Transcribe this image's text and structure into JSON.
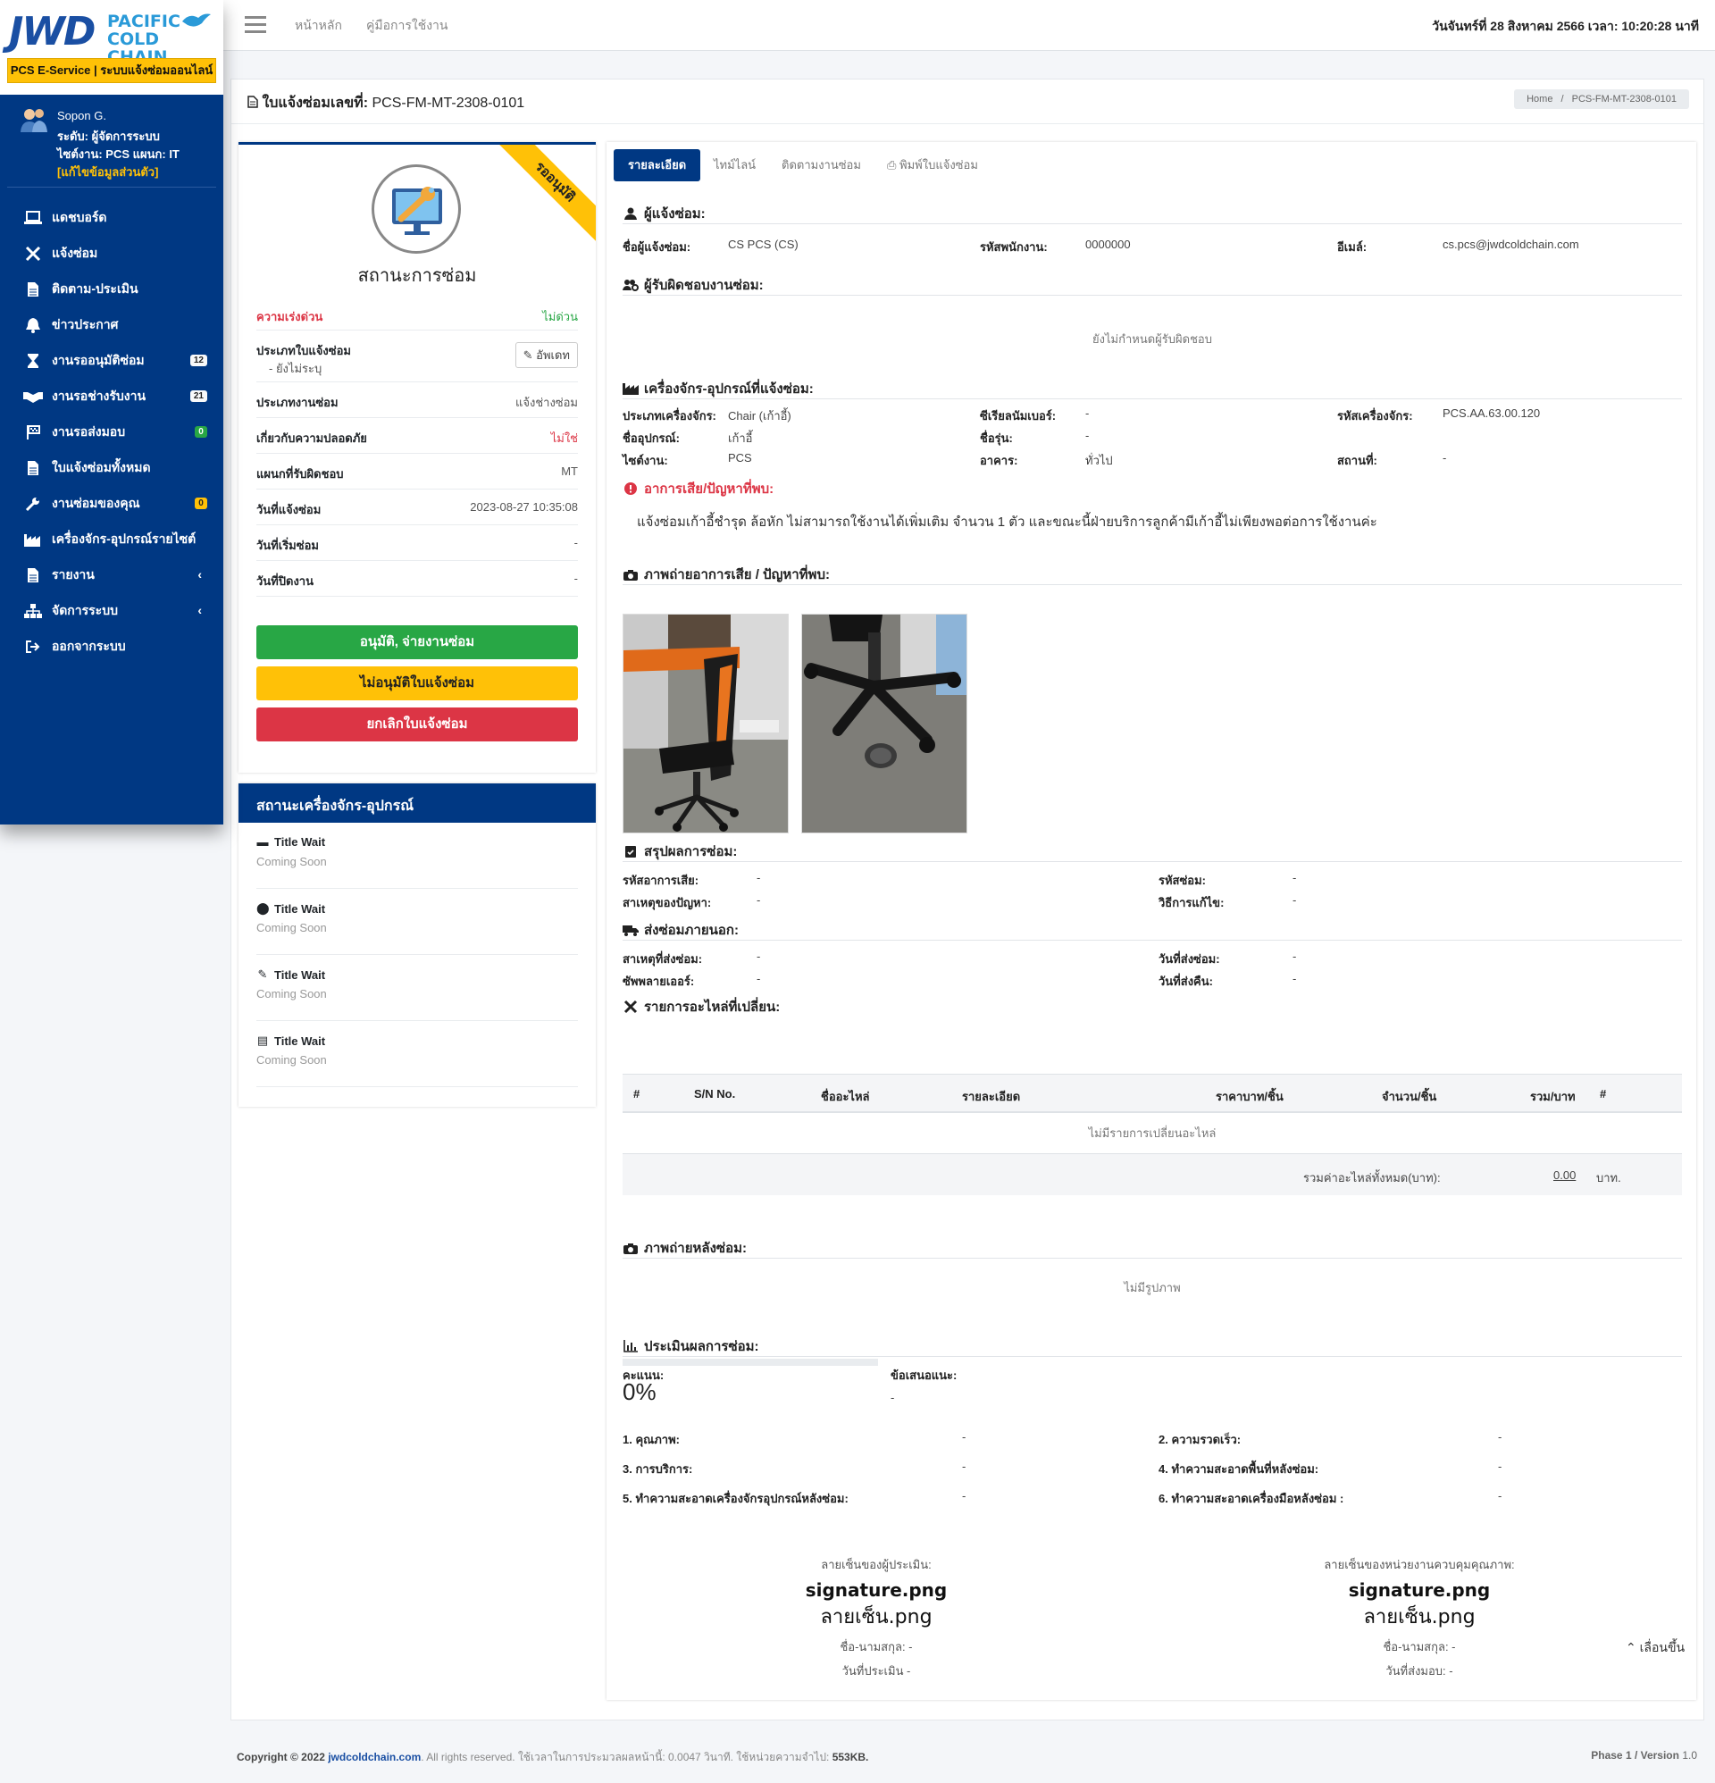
{
  "brand": {
    "logo_text": "JWD",
    "line1": "PACIFIC",
    "line2": "COLD CHAIN",
    "service_label": "PCS E-Service | ระบบแจ้งซ่อมออนไลน์"
  },
  "user": {
    "name": "Sopon G.",
    "level": "ระดับ: ผู้จัดการระบบ",
    "site": "ไซต์งาน: PCS แผนก: IT",
    "edit_link": "[แก้ไขข้อมูลส่วนตัว]"
  },
  "nav": [
    {
      "label": "แดชบอร์ด",
      "icon": "laptop-icon"
    },
    {
      "label": "แจ้งซ่อม",
      "icon": "tools-icon"
    },
    {
      "label": "ติดตาม-ประเมิน",
      "icon": "file-icon"
    },
    {
      "label": "ข่าวประกาศ",
      "icon": "bell-icon"
    },
    {
      "label": "งานรออนุมัติซ่อม",
      "icon": "hourglass-icon",
      "badge": "12"
    },
    {
      "label": "งานรอช่างรับงาน",
      "icon": "handshake-icon",
      "badge": "21"
    },
    {
      "label": "งานรอส่งมอบ",
      "icon": "flag-icon",
      "badge": "0"
    },
    {
      "label": "ใบแจ้งซ่อมทั้งหมด",
      "icon": "file-icon"
    },
    {
      "label": "งานซ่อมของคุณ",
      "icon": "wrench-icon",
      "badge": "0"
    },
    {
      "label": "เครื่องจักร-อุปกรณ์รายไซต์",
      "icon": "industry-icon"
    },
    {
      "label": "รายงาน",
      "icon": "file-icon"
    },
    {
      "label": "จัดการระบบ",
      "icon": "sitemap-icon"
    },
    {
      "label": "ออกจากระบบ",
      "icon": "signout-icon"
    }
  ],
  "topbar": {
    "home": "หน้าหลัก",
    "manual": "คู่มือการใช้งาน",
    "datetime": "วันจันทร์ที่ 28 สิงหาคม 2566 เวลา: 10:20:28 นาที"
  },
  "page": {
    "title_prefix": "ใบแจ้งซ่อมเลขที่:",
    "ticket_no": "PCS-FM-MT-2308-0101",
    "crumb_home": "Home",
    "crumb_sep": "/",
    "crumb_current": "PCS-FM-MT-2308-0101"
  },
  "status_card": {
    "ribbon": "รออนุมัติ",
    "title": "สถานะการซ่อม",
    "urgency_label": "ความเร่งด่วน",
    "urgency_value": "ไม่ด่วน",
    "type_label": "ประเภทใบแจ้งซ่อม",
    "type_value": "- ยังไม่ระบุ",
    "update_button": "อัพเดท",
    "worktype_label": "ประเภทงานซ่อม",
    "worktype_value": "แจ้งช่างซ่อม",
    "safety_label": "เกี่ยวกับความปลอดภัย",
    "safety_value": "ไม่ใช่",
    "dept_label": "แผนกที่รับผิดชอบ",
    "dept_value": "MT",
    "date_label": "วันที่แจ้งซ่อม",
    "date_value": "2023-08-27 10:35:08",
    "start_label": "วันที่เริ่มซ่อม",
    "start_value": "-",
    "close_label": "วันที่ปิดงาน",
    "close_value": "-",
    "approve_button": "อนุมัติ, จ่ายงานซ่อม",
    "reject_button": "ไม่อนุมัติใบแจ้งซ่อม",
    "cancel_button": "ยกเลิกใบแจ้งซ่อม"
  },
  "equipment_card": {
    "title": "สถานะเครื่องจักร-อุปกรณ์",
    "items": [
      {
        "title": "Title Wait",
        "sub": "Coming Soon",
        "icon": "book-icon"
      },
      {
        "title": "Title Wait",
        "sub": "Coming Soon",
        "icon": "map-marker-icon"
      },
      {
        "title": "Title Wait",
        "sub": "Coming Soon",
        "icon": "pencil-icon"
      },
      {
        "title": "Title Wait",
        "sub": "Coming Soon",
        "icon": "file-text-icon"
      }
    ]
  },
  "tabs": {
    "detail": "รายละเอียด",
    "timeline": "ไทม์ไลน์",
    "tracking": "ติดตามงานซ่อม",
    "print": "พิมพ์ใบแจ้งซ่อม"
  },
  "reporter": {
    "heading": "ผู้แจ้งซ่อม:",
    "name_label": "ชื่อผู้แจ้งซ่อม:",
    "name_value": "CS PCS (CS)",
    "emp_label": "รหัสพนักงาน:",
    "emp_value": "0000000",
    "email_label": "อีเมล์:",
    "email_value": "cs.pcs@jwdcoldchain.com"
  },
  "responsible": {
    "heading": "ผู้รับผิดชอบงานซ่อม:",
    "empty": "ยังไม่กำหนดผู้รับผิดชอบ"
  },
  "machine": {
    "heading": "เครื่องจักร-อุปกรณ์ที่แจ้งซ่อม:",
    "type_label": "ประเภทเครื่องจักร:",
    "type_value": "Chair (เก้าอี้)",
    "serial_label": "ซีเรียลนัมเบอร์:",
    "serial_value": "-",
    "code_label": "รหัสเครื่องจักร:",
    "code_value": "PCS.AA.63.00.120",
    "name_label": "ชื่ออุปกรณ์:",
    "name_value": "เก้าอี้",
    "model_label": "ชื่อรุ่น:",
    "model_value": "-",
    "site_label": "ไซต์งาน:",
    "site_value": "PCS",
    "building_label": "อาคาร:",
    "building_value": "ทั่วไป",
    "location_label": "สถานที่:",
    "location_value": "-"
  },
  "problem": {
    "heading": "อาการเสีย/ปัญหาที่พบ:",
    "text": "แจ้งซ่อมเก้าอี้ชำรุด ล้อหัก ไม่สามารถใช้งานได้เพิ่มเติม จำนวน 1 ตัว และขณะนี้ฝ่ายบริการลูกค้ามีเก้าอี้ไม่เพียงพอต่อการใช้งานค่ะ"
  },
  "photos": {
    "heading": "ภาพถ่ายอาการเสีย / ปัญหาที่พบ:"
  },
  "summary": {
    "heading": "สรุปผลการซ่อม:",
    "symptom_code_label": "รหัสอาการเสีย:",
    "symptom_code_value": "-",
    "repair_code_label": "รหัสซ่อม:",
    "repair_code_value": "-",
    "cause_label": "สาเหตุของปัญหา:",
    "cause_value": "-",
    "method_label": "วิธีการแก้ไข:",
    "method_value": "-"
  },
  "external": {
    "heading": "ส่งซ่อมภายนอก:",
    "reason_label": "สาเหตุที่ส่งซ่อม:",
    "reason_value": "-",
    "send_date_label": "วันที่ส่งซ่อม:",
    "send_date_value": "-",
    "supplier_label": "ซัพพลายเออร์:",
    "supplier_value": "-",
    "return_date_label": "วันที่ส่งคืน:",
    "return_date_value": "-"
  },
  "parts": {
    "heading": "รายการอะไหล่ที่เปลี่ยน:",
    "columns": [
      "#",
      "S/N No.",
      "ชื่ออะไหล่",
      "รายละเอียด",
      "ราคาบาท/ชิ้น",
      "จำนวน/ชิ้น",
      "รวม/บาท",
      "#"
    ],
    "empty": "ไม่มีรายการเปลี่ยนอะไหล่",
    "total_label": "รวมค่าอะไหล่ทั้งหมด(บาท):",
    "total_value": "0.00",
    "currency": "บาท."
  },
  "after_photos": {
    "heading": "ภาพถ่ายหลังซ่อม:",
    "empty": "ไม่มีรูปภาพ"
  },
  "evaluation": {
    "heading": "ประเมินผลการซ่อม:",
    "score_label": "คะแนน:",
    "score_percent": "0%",
    "score_fraction": 0,
    "suggest_label": "ข้อเสนอแนะ:",
    "suggest_value": "-",
    "q1_label": "1. คุณภาพ:",
    "q1_value": "-",
    "q2_label": "2. ความรวดเร็ว:",
    "q2_value": "-",
    "q3_label": "3. การบริการ:",
    "q3_value": "-",
    "q4_label": "4. ทำความสะอาดพื้นที่หลังซ่อม:",
    "q4_value": "-",
    "q5_label": "5. ทำความสะอาดเครื่องจักรอุปกรณ์หลังซ่อม:",
    "q5_value": "-",
    "q6_label": "6. ทำความสะอาดเครื่องมือหลังซ่อม :",
    "q6_value": "-"
  },
  "signatures": {
    "left": {
      "label": "ลายเซ็นของผู้ประเมิน:",
      "file": "signature.png",
      "alt": "ลายเซ็น.png",
      "name": "ชื่อ-นามสกุล: -",
      "date": "วันที่ประเมิน -"
    },
    "right": {
      "label": "ลายเซ็นของหน่วยงานควบคุมคุณภาพ:",
      "file": "signature.png",
      "alt": "ลายเซ็น.png",
      "name": "ชื่อ-นามสกุล: -",
      "date": "วันที่ส่งมอบ: -"
    }
  },
  "scroll_top": "เลื่อนขึ้น",
  "footer": {
    "copyright": "Copyright © 2022",
    "site": "jwdcoldchain.com",
    "rights": ". All rights reserved. ใช้เวลาในการประมวลผลหน้านี้: 0.0047 วินาที. ใช้หน่วยความจำไป:",
    "memory": "553KB.",
    "phase": "Phase 1 / Version",
    "version": "1.0"
  }
}
